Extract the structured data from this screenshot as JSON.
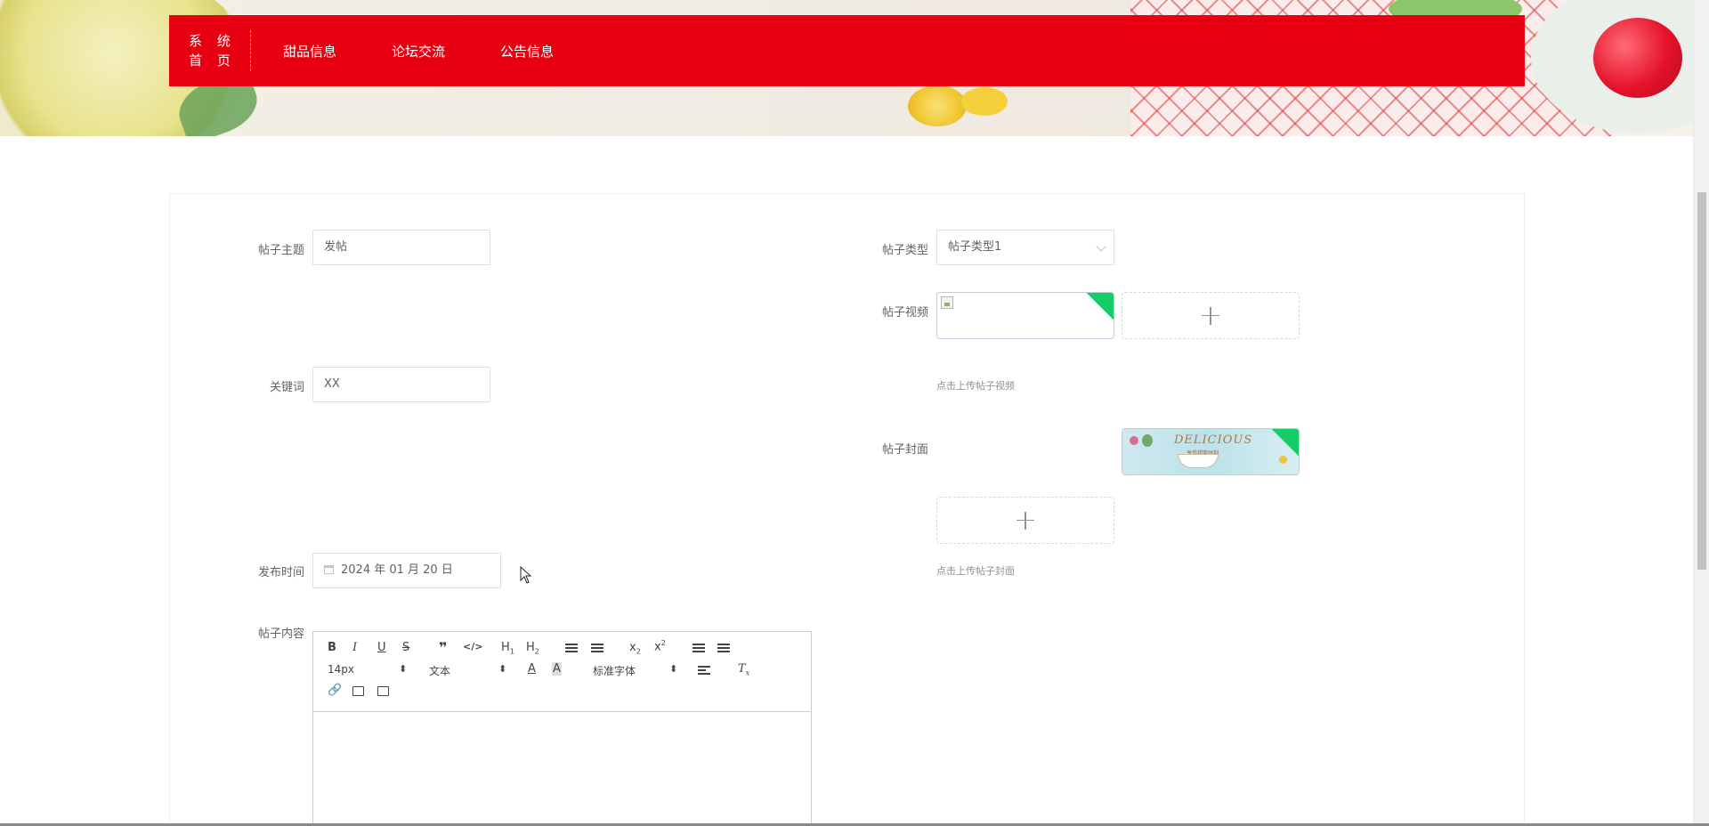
{
  "nav": {
    "home_line1": "系 统",
    "home_line2": "首 页",
    "items": [
      "甜品信息",
      "论坛交流",
      "公告信息"
    ]
  },
  "form": {
    "title_label": "帖子主题",
    "title_value": "发帖",
    "type_label": "帖子类型",
    "type_value": "帖子类型1",
    "video_label": "帖子视频",
    "video_tip": "点击上传帖子视频",
    "keyword_label": "关键词",
    "keyword_value": "XX",
    "cover_label": "帖子封面",
    "cover_tip": "点击上传帖子封面",
    "cover_image_text": "DELICIOUS",
    "cover_image_sub": "享受甜蜜时刻",
    "date_label": "发布时间",
    "date_value": "2024 年 01 月 20 日",
    "content_label": "帖子内容"
  },
  "editor": {
    "font_size": "14px",
    "header": "文本",
    "font_family": "标准字体"
  },
  "colors": {
    "nav_bg": "#e60012",
    "success_corner": "#13ce66"
  }
}
